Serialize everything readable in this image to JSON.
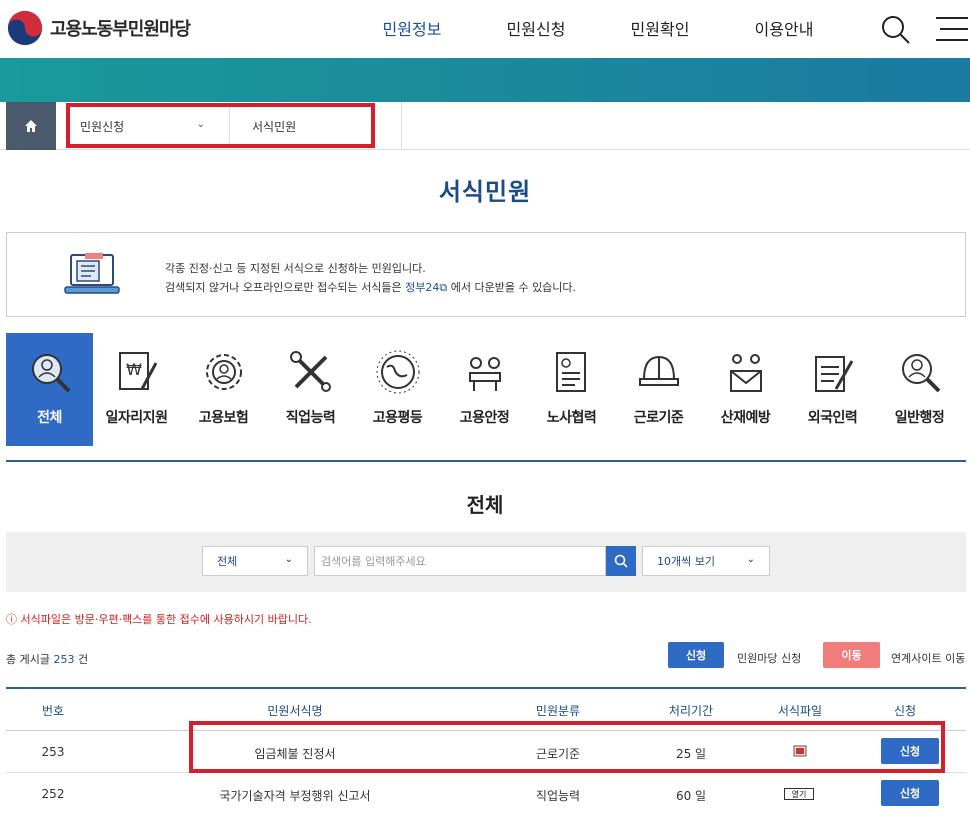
{
  "header": {
    "logo_text": "고용노동부민원마당",
    "nav": [
      "민원정보",
      "민원신청",
      "민원확인",
      "이용안내"
    ],
    "active_nav": "민원정보",
    "brand_color": "#1a4fa0"
  },
  "breadcrumb": {
    "items": [
      "민원신청",
      "서식민원"
    ]
  },
  "page_title": "서식민원",
  "info": {
    "line1": "각종 진정·신고 등 지정된 서식으로 신청하는 민원입니다.",
    "line2_prefix": "검색되지 않거나 오프라인으로만 접수되는 서식들은",
    "line2_link": "정부24",
    "line2_suffix": "에서 다운받을 수 있습니다."
  },
  "categories": [
    {
      "label": "전체",
      "icon": "search-person-icon"
    },
    {
      "label": "일자리지원",
      "icon": "won-document-icon"
    },
    {
      "label": "고용보험",
      "icon": "gear-person-icon"
    },
    {
      "label": "직업능력",
      "icon": "tools-icon"
    },
    {
      "label": "고용평등",
      "icon": "globe-icon"
    },
    {
      "label": "고용안정",
      "icon": "meeting-icon"
    },
    {
      "label": "노사협력",
      "icon": "document-icon"
    },
    {
      "label": "근로기준",
      "icon": "helmet-icon"
    },
    {
      "label": "산재예방",
      "icon": "mail-people-icon"
    },
    {
      "label": "외국인력",
      "icon": "document-pen-icon"
    },
    {
      "label": "일반행정",
      "icon": "search-person-icon"
    }
  ],
  "section_title": "전체",
  "search": {
    "scope_value": "전체",
    "placeholder": "검색어를 입력해주세요",
    "page_size": "10개씩 보기"
  },
  "notice": "ⓘ 서식파일은 방문·우편·팩스를 통한 접수에 사용하시기 바랍니다.",
  "total": {
    "prefix": "총 게시글",
    "count": "253",
    "suffix": "건"
  },
  "legend": {
    "apply_label": "신청",
    "apply_desc": "민원마당 신청",
    "move_label": "이동",
    "move_desc": "연계사이트 이동"
  },
  "table": {
    "headers": [
      "번호",
      "민원서식명",
      "민원분류",
      "처리기간",
      "서식파일",
      "신청"
    ],
    "rows": [
      {
        "no": "253",
        "name": "임금체불 진정서",
        "category": "근로기준",
        "period": "25 일",
        "file": "pdf-icon",
        "action": "신청"
      },
      {
        "no": "252",
        "name": "국가기술자격 부정행위 신고서",
        "category": "직업능력",
        "period": "60 일",
        "file": "열기",
        "action": "신청"
      }
    ]
  }
}
